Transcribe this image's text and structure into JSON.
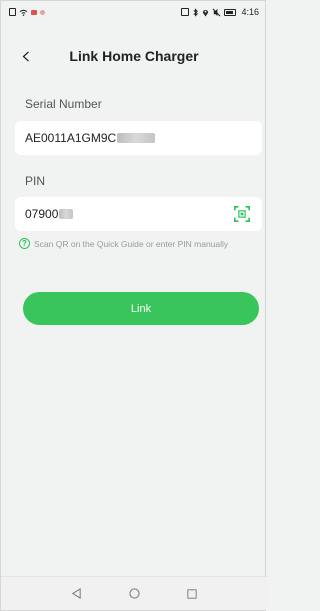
{
  "status_bar": {
    "time": "4:16",
    "icons": [
      "notification-icon",
      "wifi-icon",
      "app-icon-red",
      "nfc-icon",
      "bluetooth-icon",
      "location-icon",
      "mute-icon",
      "battery-icon"
    ]
  },
  "header": {
    "title": "Link Home Charger",
    "back_icon": "chevron-left-icon"
  },
  "form": {
    "serial_label": "Serial Number",
    "serial_value": "AE0011A1GM9C",
    "pin_label": "PIN",
    "pin_value": "07900",
    "scan_icon": "qr-scan-icon",
    "hint_text": "Scan QR on the Quick Guide or enter PIN manually",
    "hint_icon": "question-circle-icon"
  },
  "actions": {
    "link_label": "Link"
  },
  "colors": {
    "accent": "#3ac45c",
    "background": "#f1f3f2",
    "field": "#ffffff"
  },
  "nav": {
    "icons": [
      "back-triangle-icon",
      "home-circle-icon",
      "recents-square-icon"
    ]
  }
}
